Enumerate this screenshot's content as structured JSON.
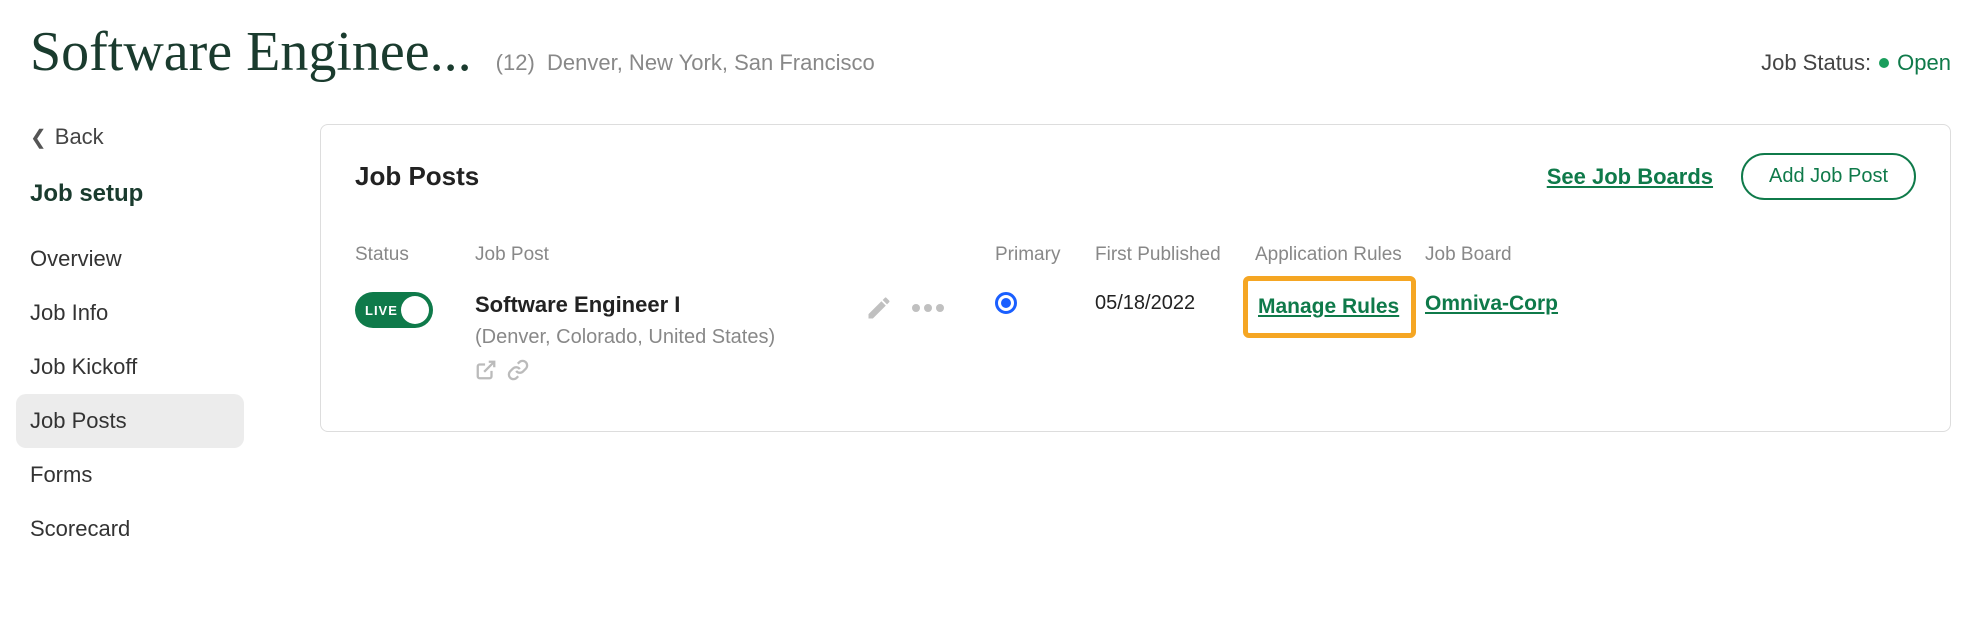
{
  "header": {
    "title": "Software Enginee...",
    "count_label": "(12)",
    "locations": "Denver, New York, San Francisco",
    "status_label": "Job Status:",
    "status_value": "Open"
  },
  "sidebar": {
    "back_label": "Back",
    "heading": "Job setup",
    "items": [
      {
        "label": "Overview",
        "active": false
      },
      {
        "label": "Job Info",
        "active": false
      },
      {
        "label": "Job Kickoff",
        "active": false
      },
      {
        "label": "Job Posts",
        "active": true
      },
      {
        "label": "Forms",
        "active": false
      },
      {
        "label": "Scorecard",
        "active": false
      }
    ]
  },
  "panel": {
    "title": "Job Posts",
    "see_boards_label": "See Job Boards",
    "add_post_label": "Add Job Post",
    "columns": {
      "status": "Status",
      "post": "Job Post",
      "primary": "Primary",
      "published": "First Published",
      "rules": "Application Rules",
      "board": "Job Board"
    },
    "rows": [
      {
        "live_label": "LIVE",
        "title": "Software Engineer I",
        "location": "(Denver, Colorado, United States)",
        "published": "05/18/2022",
        "rules_link": "Manage Rules",
        "board_link": "Omniva-Corp"
      }
    ]
  }
}
